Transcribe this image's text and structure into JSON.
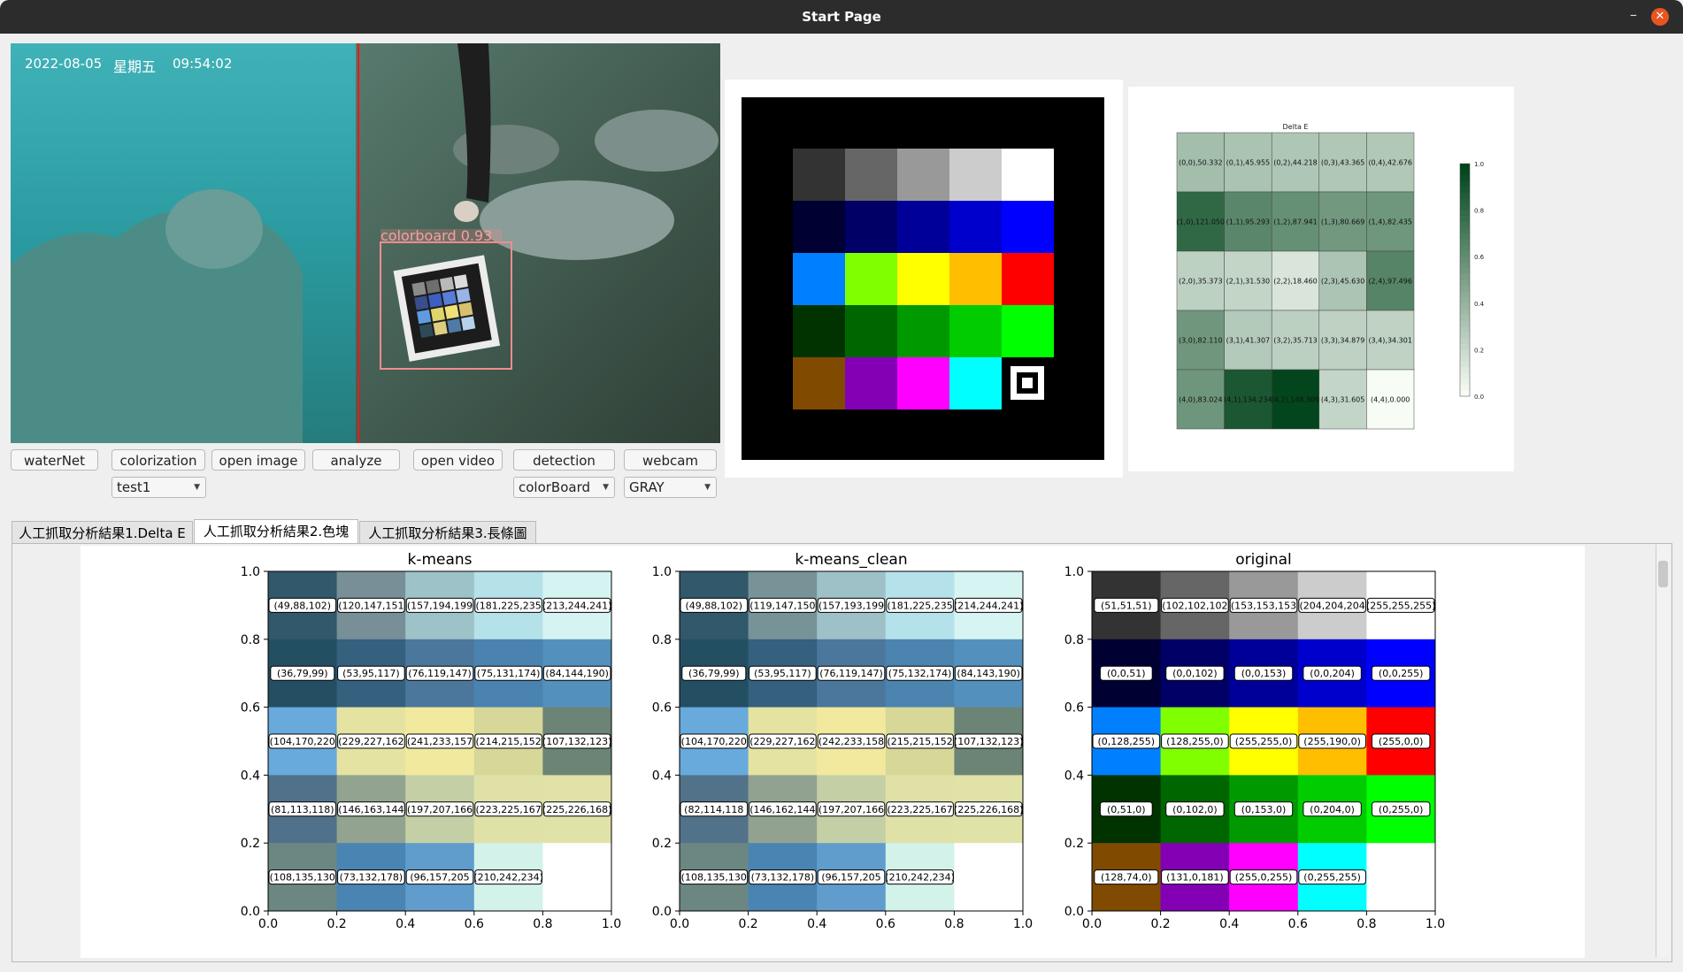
{
  "window": {
    "title": "Start Page",
    "minimize": "–",
    "close": "✕"
  },
  "video": {
    "date": "2022-08-05",
    "weekday": "星期五",
    "time": "09:54:02",
    "detection_label": "colorboard 0.93"
  },
  "buttons": [
    "waterNet",
    "colorization",
    "open image",
    "analyze",
    "open video",
    "detection",
    "webcam"
  ],
  "selects": {
    "model": "test1",
    "target": "colorBoard",
    "mode": "GRAY"
  },
  "tabs": [
    "人工抓取分析結果1.Delta E",
    "人工抓取分析結果2.色塊",
    "人工抓取分析結果3.長條圖"
  ],
  "active_tab": 1,
  "colorboard_rows": [
    [
      "#333333",
      "#666666",
      "#999999",
      "#cccccc",
      "#ffffff"
    ],
    [
      "#000033",
      "#000066",
      "#000099",
      "#0000cc",
      "#0000ff"
    ],
    [
      "#0080ff",
      "#80ff00",
      "#ffff00",
      "#ffbe00",
      "#ff0000"
    ],
    [
      "#003300",
      "#006600",
      "#009900",
      "#00cc00",
      "#00ff00"
    ],
    [
      "#804a00",
      "#8300b5",
      "#ff00ff",
      "#00ffff",
      "marker"
    ]
  ],
  "chart_data": [
    {
      "type": "heatmap",
      "title": "Delta E",
      "rows": 5,
      "cols": 5,
      "cells": [
        [
          "(0,0),50.332",
          "(0,1),45.955",
          "(0,2),44.218",
          "(0,3),43.365",
          "(0,4),42.676"
        ],
        [
          "(1,0),121.050",
          "(1,1),95.293",
          "(1,2),87.941",
          "(1,3),80.669",
          "(1,4),82.435"
        ],
        [
          "(2,0),35.373",
          "(2,1),31.530",
          "(2,2),18.460",
          "(2,3),45.630",
          "(2,4),97.496"
        ],
        [
          "(3,0),82.110",
          "(3,1),41.307",
          "(3,2),35.713",
          "(3,3),34.879",
          "(3,4),34.301"
        ],
        [
          "(4,0),83.024",
          "(4,1),134.234",
          "(4,2),148.309",
          "(4,3),31.605",
          "(4,4),0.000"
        ]
      ],
      "values": [
        [
          50.332,
          45.955,
          44.218,
          43.365,
          42.676
        ],
        [
          121.05,
          95.293,
          87.941,
          80.669,
          82.435
        ],
        [
          35.373,
          31.53,
          18.46,
          45.63,
          97.496
        ],
        [
          82.11,
          41.307,
          35.713,
          34.879,
          34.301
        ],
        [
          83.024,
          134.234,
          148.309,
          31.605,
          0
        ]
      ],
      "colorbar_ticks": [
        "0.0",
        "0.2",
        "0.4",
        "0.6",
        "0.8",
        "1.0"
      ],
      "colormap": "Greens"
    },
    {
      "type": "heatmap",
      "title": "k-means",
      "xlim": [
        0,
        1
      ],
      "ylim": [
        0,
        1
      ],
      "xticks": [
        "0.0",
        "0.2",
        "0.4",
        "0.6",
        "0.8",
        "1.0"
      ],
      "yticks": [
        "0.0",
        "0.2",
        "0.4",
        "0.6",
        "0.8",
        "1.0"
      ],
      "bands": [
        {
          "top": [
            "#31586b",
            "#788f97",
            "#9dc2c7",
            "#b5e1e9",
            "#d5f4f1"
          ],
          "bottom": [
            "#31586b",
            "#788f97",
            "#9dc2c7",
            "#b5e1e9",
            "#d5f4f1"
          ],
          "labels": [
            "(49,88,102)",
            "(120,147,151",
            "(157,194,199",
            "(181,225,235",
            "(213,244,241)"
          ]
        },
        {
          "top": [
            "#244f63",
            "#35607e",
            "#4c779c",
            "#4b83b0",
            "#5490be"
          ],
          "bottom": [
            "#244f63",
            "#35607e",
            "#4c779c",
            "#4b83b0",
            "#5490be"
          ],
          "labels": [
            "(36,79,99)",
            "(53,95,117)",
            "(76,119,147)",
            "(75,131,174)",
            "(84,144,190)"
          ]
        },
        {
          "top": [
            "#68aadc",
            "#e5e3a2",
            "#f1e99d",
            "#d6d798",
            "#6b8476"
          ],
          "bottom": [
            "#68aadc",
            "#e5e3a2",
            "#f1e99d",
            "#d6d798",
            "#6b8476"
          ],
          "labels": [
            "(104,170,220",
            "(229,227,162",
            "(241,233,157",
            "(214,215,152",
            "(107,132,123)"
          ]
        },
        {
          "top": [
            "#51718a",
            "#92a390",
            "#c5cfa5",
            "#dfe1a7",
            "#e1e2a8"
          ],
          "bottom": [
            "#51718a",
            "#92a390",
            "#c5cfa5",
            "#dfe1a7",
            "#e1e2a8"
          ],
          "labels": [
            "(81,113,118)",
            "(146,163,144",
            "(197,207,166",
            "(223,225,167",
            "(225,226,168)"
          ]
        },
        {
          "top": [
            "#6c8782",
            "#4984b2",
            "#609dcd",
            "#d2f2ea",
            "#ffffff"
          ],
          "bottom": [
            "#6c8782",
            "#4984b2",
            "#609dcd",
            "#d2f2ea",
            "#ffffff"
          ],
          "labels": [
            "(108,135,130",
            "(73,132,178)",
            "(96,157,205",
            "(210,242,234)",
            ""
          ]
        }
      ]
    },
    {
      "type": "heatmap",
      "title": "k-means_clean",
      "xlim": [
        0,
        1
      ],
      "ylim": [
        0,
        1
      ],
      "xticks": [
        "0.0",
        "0.2",
        "0.4",
        "0.6",
        "0.8",
        "1.0"
      ],
      "yticks": [
        "0.0",
        "0.2",
        "0.4",
        "0.6",
        "0.8",
        "1.0"
      ],
      "bands": [
        {
          "top": [
            "#31586b",
            "#779397",
            "#9dc1c7",
            "#b5e1eb",
            "#d6f4f1"
          ],
          "bottom": [
            "#31586b",
            "#779397",
            "#9dc1c7",
            "#b5e1eb",
            "#d6f4f1"
          ],
          "labels": [
            "(49,88,102)",
            "(119,147,150",
            "(157,193,199",
            "(181,225,235",
            "(214,244,241)"
          ]
        },
        {
          "top": [
            "#244f63",
            "#35607e",
            "#4c779c",
            "#4b84ae",
            "#5490be"
          ],
          "bottom": [
            "#244f63",
            "#35607e",
            "#4c779c",
            "#4b84ae",
            "#5490be"
          ],
          "labels": [
            "(36,79,99)",
            "(53,95,117)",
            "(76,119,147)",
            "(75,132,174)",
            "(84,143,190)"
          ]
        },
        {
          "top": [
            "#68aadc",
            "#e5e3a2",
            "#f2e99e",
            "#d7d798",
            "#6b8476"
          ],
          "bottom": [
            "#68aadc",
            "#e5e3a2",
            "#f2e99e",
            "#d7d798",
            "#6b8476"
          ],
          "labels": [
            "(104,170,220",
            "(229,227,162",
            "(242,233,158",
            "(215,215,152",
            "(107,132,123)"
          ]
        },
        {
          "top": [
            "#52728a",
            "#92a290",
            "#c5cfa6",
            "#dfe1a7",
            "#e1e2a8"
          ],
          "bottom": [
            "#52728a",
            "#92a290",
            "#c5cfa6",
            "#dfe1a7",
            "#e1e2a8"
          ],
          "labels": [
            "(82,114,118",
            "(146,162,144",
            "(197,207,166",
            "(223,225,167",
            "(225,226,168)"
          ]
        },
        {
          "top": [
            "#6c8782",
            "#4984b2",
            "#609dcd",
            "#d2f2ea",
            "#ffffff"
          ],
          "bottom": [
            "#6c8782",
            "#4984b2",
            "#609dcd",
            "#d2f2ea",
            "#ffffff"
          ],
          "labels": [
            "(108,135,130",
            "(73,132,178)",
            "(96,157,205",
            "(210,242,234)",
            ""
          ]
        }
      ]
    },
    {
      "type": "heatmap",
      "title": "original",
      "xlim": [
        0,
        1
      ],
      "ylim": [
        0,
        1
      ],
      "xticks": [
        "0.0",
        "0.2",
        "0.4",
        "0.6",
        "0.8",
        "1.0"
      ],
      "yticks": [
        "0.0",
        "0.2",
        "0.4",
        "0.6",
        "0.8",
        "1.0"
      ],
      "bands": [
        {
          "top": [
            "#333333",
            "#666666",
            "#999999",
            "#cccccc",
            "#ffffff"
          ],
          "bottom": [
            "#333333",
            "#666666",
            "#999999",
            "#cccccc",
            "#ffffff"
          ],
          "labels": [
            "(51,51,51)",
            "(102,102,102",
            "(153,153,153",
            "(204,204,204",
            "(255,255,255)"
          ]
        },
        {
          "top": [
            "#000033",
            "#000066",
            "#000099",
            "#0000cc",
            "#0000ff"
          ],
          "bottom": [
            "#000033",
            "#000066",
            "#000099",
            "#0000cc",
            "#0000ff"
          ],
          "labels": [
            "(0,0,51)",
            "(0,0,102)",
            "(0,0,153)",
            "(0,0,204)",
            "(0,0,255)"
          ]
        },
        {
          "top": [
            "#0080ff",
            "#80ff00",
            "#ffff00",
            "#ffbe00",
            "#ff0000"
          ],
          "bottom": [
            "#0080ff",
            "#80ff00",
            "#ffff00",
            "#ffbe00",
            "#ff0000"
          ],
          "labels": [
            "(0,128,255)",
            "(128,255,0)",
            "(255,255,0)",
            "(255,190,0)",
            "(255,0,0)"
          ]
        },
        {
          "top": [
            "#003300",
            "#006600",
            "#009900",
            "#00cc00",
            "#00ff00"
          ],
          "bottom": [
            "#003300",
            "#006600",
            "#009900",
            "#00cc00",
            "#00ff00"
          ],
          "labels": [
            "(0,51,0)",
            "(0,102,0)",
            "(0,153,0)",
            "(0,204,0)",
            "(0,255,0)"
          ]
        },
        {
          "top": [
            "#804a00",
            "#8300b5",
            "#ff00ff",
            "#00ffff",
            "#ffffff"
          ],
          "bottom": [
            "#804a00",
            "#8300b5",
            "#ff00ff",
            "#00ffff",
            "#ffffff"
          ],
          "labels": [
            "(128,74,0)",
            "(131,0,181)",
            "(255,0,255)",
            "(0,255,255)",
            ""
          ]
        }
      ]
    }
  ]
}
